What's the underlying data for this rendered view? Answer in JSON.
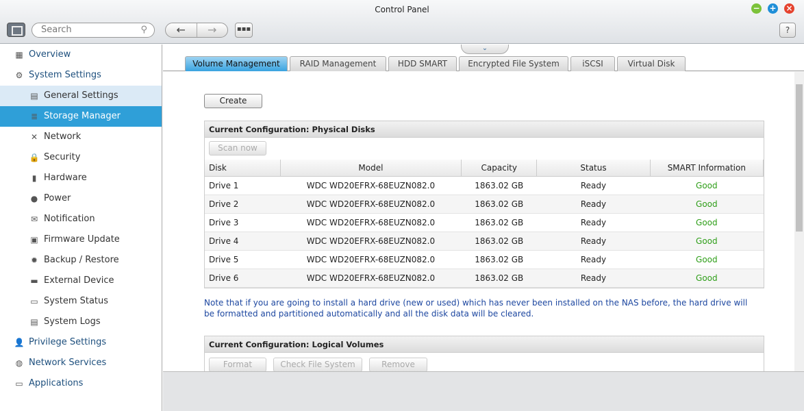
{
  "window": {
    "title": "Control Panel",
    "help": "?"
  },
  "toolbar": {
    "search_placeholder": "Search",
    "back": "←",
    "forward": "→",
    "apps": "▪▪▪"
  },
  "sidebar": {
    "items": [
      {
        "label": "Overview",
        "level": "top",
        "icon": "overview-icon",
        "glyph": "▦"
      },
      {
        "label": "System Settings",
        "level": "top",
        "icon": "gear-icon",
        "glyph": "⚙"
      },
      {
        "label": "General Settings",
        "level": "sub",
        "icon": "general-settings-icon",
        "glyph": "▤",
        "state": "hover"
      },
      {
        "label": "Storage Manager",
        "level": "sub",
        "icon": "storage-icon",
        "glyph": "≣",
        "state": "selected"
      },
      {
        "label": "Network",
        "level": "sub",
        "icon": "network-icon",
        "glyph": "✕"
      },
      {
        "label": "Security",
        "level": "sub",
        "icon": "lock-icon",
        "glyph": "🔒"
      },
      {
        "label": "Hardware",
        "level": "sub",
        "icon": "hardware-icon",
        "glyph": "▮"
      },
      {
        "label": "Power",
        "level": "sub",
        "icon": "power-icon",
        "glyph": "●"
      },
      {
        "label": "Notification",
        "level": "sub",
        "icon": "notification-icon",
        "glyph": "✉"
      },
      {
        "label": "Firmware Update",
        "level": "sub",
        "icon": "firmware-icon",
        "glyph": "▣"
      },
      {
        "label": "Backup / Restore",
        "level": "sub",
        "icon": "backup-icon",
        "glyph": "✹"
      },
      {
        "label": "External Device",
        "level": "sub",
        "icon": "external-device-icon",
        "glyph": "▬"
      },
      {
        "label": "System Status",
        "level": "sub",
        "icon": "monitor-icon",
        "glyph": "▭"
      },
      {
        "label": "System Logs",
        "level": "sub",
        "icon": "logs-icon",
        "glyph": "▤"
      },
      {
        "label": "Privilege Settings",
        "level": "top",
        "icon": "user-icon",
        "glyph": "👤"
      },
      {
        "label": "Network Services",
        "level": "top",
        "icon": "globe-icon",
        "glyph": "◍"
      },
      {
        "label": "Applications",
        "level": "top",
        "icon": "applications-icon",
        "glyph": "▭"
      }
    ]
  },
  "tabs": [
    "Volume Management",
    "RAID Management",
    "HDD SMART",
    "Encrypted File System",
    "iSCSI",
    "Virtual Disk"
  ],
  "main": {
    "create": "Create",
    "physical": {
      "title": "Current Configuration: Physical Disks",
      "scan": "Scan now",
      "columns": [
        "Disk",
        "Model",
        "Capacity",
        "Status",
        "SMART Information"
      ],
      "rows": [
        [
          "Drive 1",
          "WDC WD20EFRX-68EUZN082.0",
          "1863.02 GB",
          "Ready",
          "Good"
        ],
        [
          "Drive 2",
          "WDC WD20EFRX-68EUZN082.0",
          "1863.02 GB",
          "Ready",
          "Good"
        ],
        [
          "Drive 3",
          "WDC WD20EFRX-68EUZN082.0",
          "1863.02 GB",
          "Ready",
          "Good"
        ],
        [
          "Drive 4",
          "WDC WD20EFRX-68EUZN082.0",
          "1863.02 GB",
          "Ready",
          "Good"
        ],
        [
          "Drive 5",
          "WDC WD20EFRX-68EUZN082.0",
          "1863.02 GB",
          "Ready",
          "Good"
        ],
        [
          "Drive 6",
          "WDC WD20EFRX-68EUZN082.0",
          "1863.02 GB",
          "Ready",
          "Good"
        ]
      ]
    },
    "note": "Note that if you are going to install a hard drive (new or used) which has never been installed on the NAS before, the hard drive will be formatted and partitioned automatically and all the disk data will be cleared.",
    "logical": {
      "title": "Current Configuration: Logical Volumes",
      "buttons": [
        "Format",
        "Check File System",
        "Remove"
      ]
    }
  },
  "colors": {
    "accent": "#2f9fd8",
    "good": "#2e9e18",
    "note": "#1d47a0"
  }
}
